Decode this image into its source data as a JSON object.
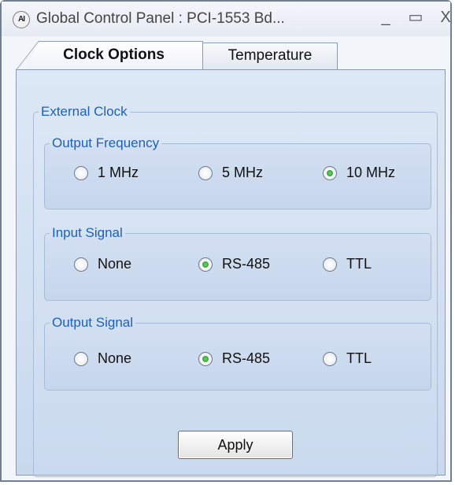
{
  "window": {
    "title": "Global Control Panel : PCI-1553 Bd...",
    "app_icon_text": "AI",
    "minimize_glyph": "_",
    "maximize_glyph": "▭",
    "close_glyph": "X"
  },
  "tabs": [
    {
      "label": "Clock Options",
      "selected": true
    },
    {
      "label": "Temperature",
      "selected": false
    }
  ],
  "external_clock": {
    "label": "External Clock",
    "output_frequency": {
      "label": "Output Frequency",
      "options": [
        "1 MHz",
        "5 MHz",
        "10 MHz"
      ],
      "selected": "10 MHz"
    },
    "input_signal": {
      "label": "Input Signal",
      "options": [
        "None",
        "RS-485",
        "TTL"
      ],
      "selected": "RS-485"
    },
    "output_signal": {
      "label": "Output Signal",
      "options": [
        "None",
        "RS-485",
        "TTL"
      ],
      "selected": "RS-485"
    }
  },
  "apply_button": {
    "label": "Apply"
  },
  "colors": {
    "group_label": "#1f5fb5",
    "radio_selected": "#2e9b2e"
  },
  "icons": {
    "app": "ai-logo-icon",
    "minimize": "minimize-icon",
    "maximize": "maximize-icon",
    "close": "close-icon"
  }
}
